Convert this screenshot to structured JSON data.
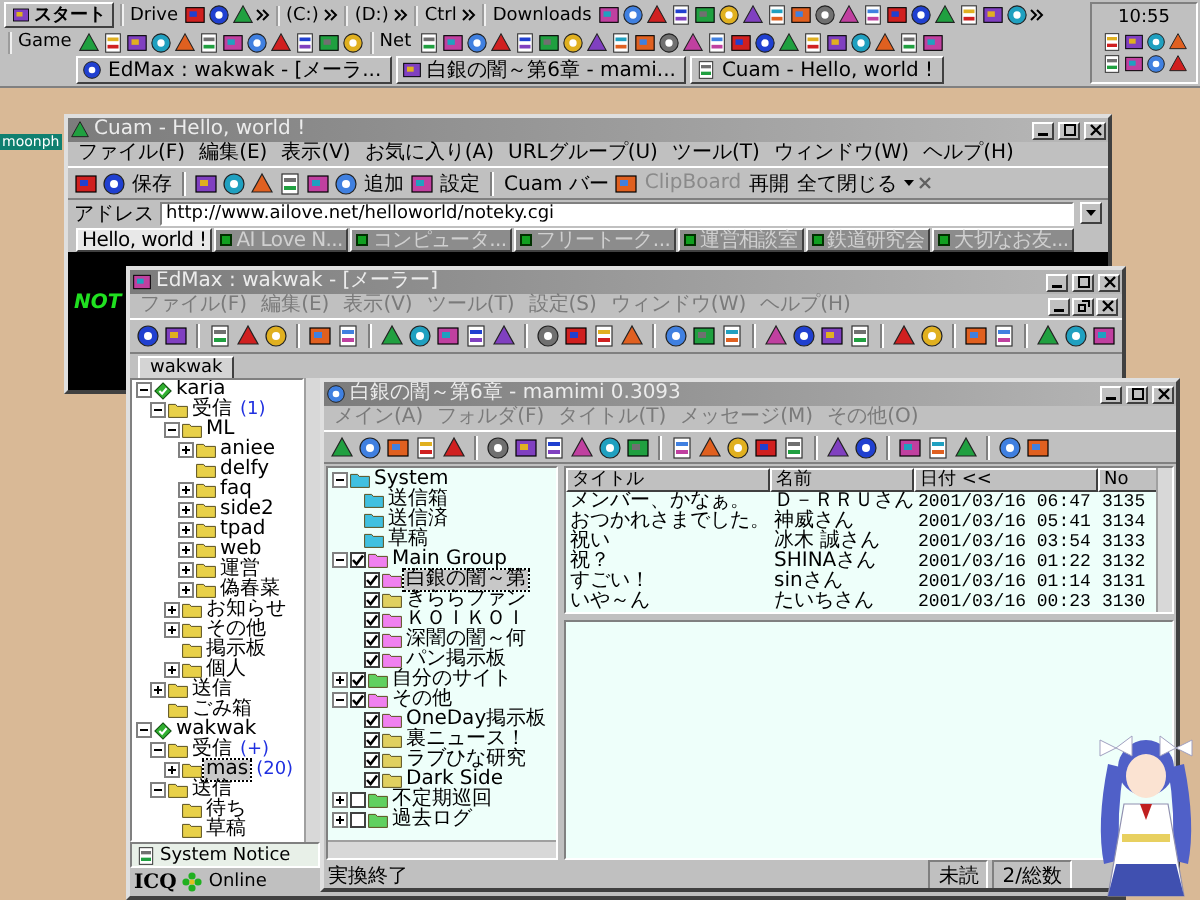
{
  "taskbar": {
    "start_button": "スタート",
    "bands_row1": [
      "Drive",
      "(C:)",
      "(D:)",
      "Ctrl",
      "Downloads"
    ],
    "bands_row2": [
      "Game",
      "Net"
    ],
    "tasks": [
      {
        "label": "EdMax : wakwak - [メーラ...",
        "selected": false
      },
      {
        "label": "白銀の闇～第6章 - mami...",
        "selected": false
      },
      {
        "label": "Cuam - Hello, world !",
        "selected": false
      }
    ],
    "clock": "10:55"
  },
  "desktop_label": "moonph",
  "cuam": {
    "title": "Cuam - Hello, world !",
    "menu": {
      "dimmed": false,
      "items": [
        "ファイル(F)",
        "編集(E)",
        "表示(V)",
        "お気に入り(A)",
        "URLグループ(U)",
        "ツール(T)",
        "ウィンドウ(W)",
        "ヘルプ(H)"
      ]
    },
    "toolbar": [
      {
        "label": "保存",
        "disabled": false
      },
      {
        "label": "追加",
        "disabled": false
      },
      {
        "label": "設定",
        "disabled": false
      },
      {
        "label": "Cuam バー",
        "disabled": false
      },
      {
        "label": "ClipBoard",
        "disabled": true
      },
      {
        "label": "再開",
        "disabled": false
      },
      {
        "label": "全て閉じる",
        "disabled": false
      }
    ],
    "address_label": "アドレス",
    "address": "http://www.ailove.net/helloworld/noteky.cgi",
    "tabs": [
      {
        "label": "Hello, world !",
        "selected": true
      },
      {
        "label": "AI Love N...",
        "selected": false
      },
      {
        "label": "コンピュータ...",
        "selected": false
      },
      {
        "label": "フリートーク...",
        "selected": false
      },
      {
        "label": "運営相談室",
        "selected": false
      },
      {
        "label": "鉄道研究会",
        "selected": false
      },
      {
        "label": "大切なお友...",
        "selected": false
      }
    ],
    "page_text": "NOT"
  },
  "edmax": {
    "title": "EdMax : wakwak - [メーラー]",
    "menu": {
      "dimmed": true,
      "items": [
        "ファイル(F)",
        "編集(E)",
        "表示(V)",
        "ツール(T)",
        "設定(S)",
        "ウィンドウ(W)",
        "ヘルプ(H)"
      ]
    },
    "tabs": [
      {
        "label": "wakwak",
        "selected": true
      }
    ],
    "tree": [
      {
        "label": "karia",
        "kind": "account",
        "expanded": true,
        "selected": false,
        "children": [
          {
            "label": "受信",
            "count": "(1)",
            "kind": "folder",
            "expanded": true,
            "selected": false,
            "children": [
              {
                "label": "ML",
                "kind": "folder",
                "expanded": true,
                "selected": false,
                "children": [
                  {
                    "label": "aniee",
                    "kind": "folder",
                    "expanded": false,
                    "selected": false
                  },
                  {
                    "label": "delfy",
                    "kind": "folder",
                    "selected": false
                  },
                  {
                    "label": "faq",
                    "kind": "folder",
                    "expanded": false,
                    "selected": false
                  },
                  {
                    "label": "side2",
                    "kind": "folder",
                    "expanded": false,
                    "selected": false
                  },
                  {
                    "label": "tpad",
                    "kind": "folder",
                    "expanded": false,
                    "selected": false
                  },
                  {
                    "label": "web",
                    "kind": "folder",
                    "expanded": false,
                    "selected": false
                  },
                  {
                    "label": "運営",
                    "kind": "folder",
                    "expanded": false,
                    "selected": false
                  },
                  {
                    "label": "偽春菜",
                    "kind": "folder",
                    "expanded": false,
                    "selected": false
                  }
                ]
              },
              {
                "label": "お知らせ",
                "kind": "folder",
                "expanded": false,
                "selected": false
              },
              {
                "label": "その他",
                "kind": "folder",
                "expanded": false,
                "selected": false
              },
              {
                "label": "掲示板",
                "kind": "folder",
                "selected": false
              },
              {
                "label": "個人",
                "kind": "folder",
                "expanded": false,
                "selected": false
              }
            ]
          },
          {
            "label": "送信",
            "kind": "folder",
            "expanded": false,
            "selected": false
          },
          {
            "label": "ごみ箱",
            "kind": "folder",
            "selected": false
          }
        ]
      },
      {
        "label": "wakwak",
        "kind": "account",
        "expanded": true,
        "selected": false,
        "children": [
          {
            "label": "受信",
            "count": "(+)",
            "kind": "folder",
            "expanded": true,
            "selected": false,
            "children": [
              {
                "label": "mas",
                "count": "(20)",
                "kind": "folder",
                "expanded": false,
                "selected": true
              }
            ]
          },
          {
            "label": "送信",
            "kind": "folder",
            "expanded": true,
            "selected": false,
            "children": [
              {
                "label": "待ち",
                "kind": "folder",
                "selected": false
              },
              {
                "label": "草稿",
                "kind": "folder",
                "selected": false
              }
            ]
          }
        ]
      }
    ],
    "notice": "System Notice",
    "icq_logo": "ICQ",
    "icq_status": "Online"
  },
  "mamimi": {
    "title": "白銀の闇～第6章 - mamimi 0.3093",
    "menu": {
      "dimmed": true,
      "items": [
        "メイン(A)",
        "フォルダ(F)",
        "タイトル(T)",
        "メッセージ(M)",
        "その他(O)"
      ]
    },
    "tree": [
      {
        "label": "System",
        "kind": "folder",
        "color": "#40c0e0",
        "expanded": true,
        "selected": false,
        "children": [
          {
            "label": "送信箱",
            "kind": "folder",
            "color": "#40c0e0",
            "selected": false
          },
          {
            "label": "送信済",
            "kind": "folder",
            "color": "#40c0e0",
            "selected": false
          },
          {
            "label": "草稿",
            "kind": "folder",
            "color": "#40c0e0",
            "selected": false
          }
        ]
      },
      {
        "label": "Main Group",
        "kind": "folder",
        "color": "#f080f0",
        "checked": true,
        "expanded": true,
        "selected": false,
        "children": [
          {
            "label": "白銀の闇～第",
            "kind": "folder",
            "color": "#f080f0",
            "checked": true,
            "selected": true
          },
          {
            "label": "きららファン",
            "kind": "folder",
            "color": "#e0d060",
            "checked": true,
            "selected": false
          },
          {
            "label": "ＫＯＩＫＯＩ",
            "kind": "folder",
            "color": "#f080f0",
            "checked": true,
            "selected": false
          },
          {
            "label": "深闇の闇～何",
            "kind": "folder",
            "color": "#f080f0",
            "checked": true,
            "selected": false
          },
          {
            "label": "パン掲示板",
            "kind": "folder",
            "color": "#f080f0",
            "checked": true,
            "selected": false
          }
        ]
      },
      {
        "label": "自分のサイト",
        "kind": "folder",
        "color": "#60d060",
        "checked": true,
        "expanded": false,
        "selected": false
      },
      {
        "label": "その他",
        "kind": "folder",
        "color": "#f080f0",
        "checked": true,
        "expanded": true,
        "selected": false,
        "children": [
          {
            "label": "OneDay掲示板",
            "kind": "folder",
            "color": "#f080f0",
            "checked": true,
            "selected": false
          },
          {
            "label": "裏ニュース！",
            "kind": "folder",
            "color": "#e0d060",
            "checked": true,
            "selected": false
          },
          {
            "label": "ラブひな研究",
            "kind": "folder",
            "color": "#e0d060",
            "checked": true,
            "selected": false
          },
          {
            "label": "Dark Side",
            "kind": "folder",
            "color": "#e0d060",
            "checked": true,
            "selected": false
          }
        ]
      },
      {
        "label": "不定期巡回",
        "kind": "folder",
        "color": "#60d060",
        "checked": false,
        "expanded": false,
        "selected": false
      },
      {
        "label": "過去ログ",
        "kind": "folder",
        "color": "#60d060",
        "checked": false,
        "expanded": false,
        "selected": false
      }
    ],
    "columns": [
      "タイトル",
      "名前",
      "日付 <<",
      "No"
    ],
    "rows": [
      [
        "メンバー、かなぁ。",
        "Ｄ－ＲＲＵさん",
        "2001/03/16 06:47",
        "3135"
      ],
      [
        "おつかれさまでした。",
        "神威さん",
        "2001/03/16 05:41",
        "3134"
      ],
      [
        "祝い",
        "冰木 誠さん",
        "2001/03/16 03:54",
        "3133"
      ],
      [
        "祝？",
        "SHINAさん",
        "2001/03/16 01:22",
        "3132"
      ],
      [
        "すごい！",
        "sinさん",
        "2001/03/16 01:14",
        "3131"
      ],
      [
        "いや～ん",
        "たいちさん",
        "2001/03/16 00:23",
        "3130"
      ]
    ],
    "status": "実換終了",
    "status_right": [
      "未読",
      "2/総数"
    ]
  }
}
